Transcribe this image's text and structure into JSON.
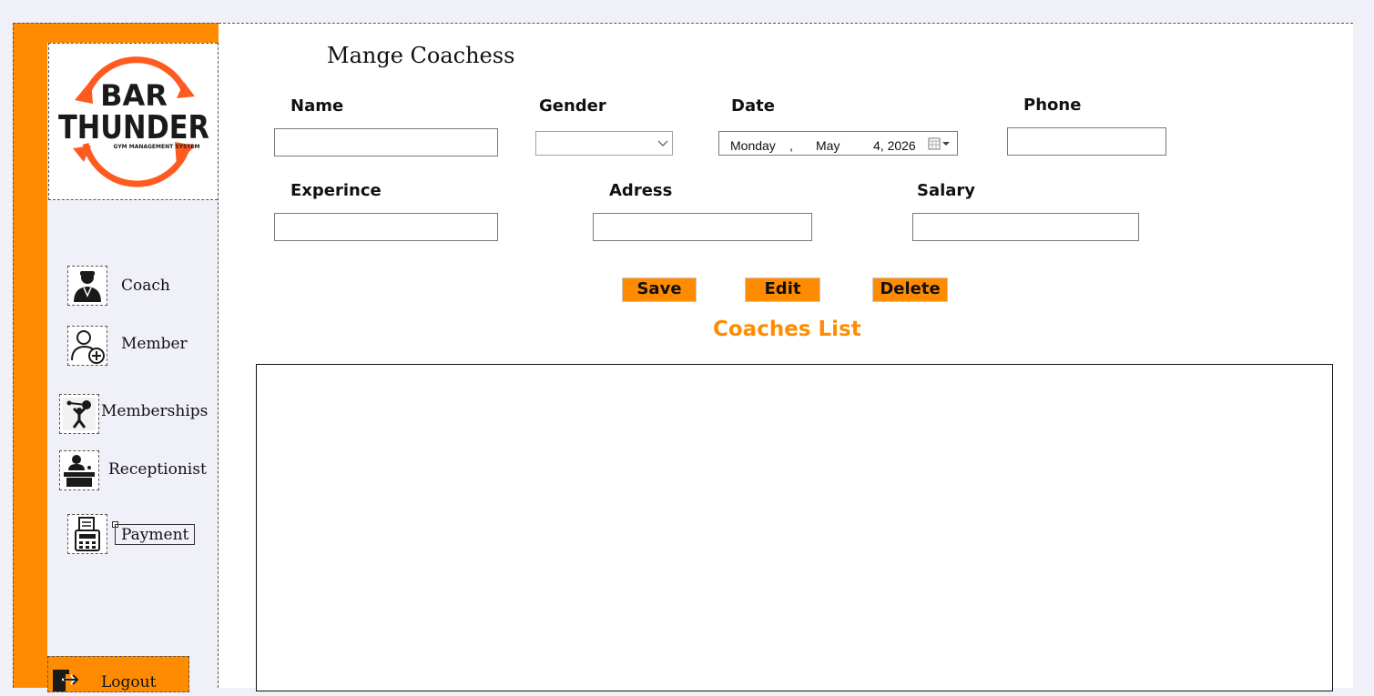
{
  "page": {
    "title": "Mange Coachess"
  },
  "logo": {
    "line1": "BAR",
    "line2": "THUNDER",
    "tagline": "GYM MANAGEMENT SYSTEM",
    "brand_color": "#ff5a1f"
  },
  "sidebar": {
    "items": [
      {
        "label": "Coach",
        "icon": "coach-icon"
      },
      {
        "label": "Member",
        "icon": "add-member-icon"
      },
      {
        "label": "Memberships",
        "icon": "weightlifter-icon"
      },
      {
        "label": "Receptionist",
        "icon": "receptionist-icon"
      },
      {
        "label": "Payment",
        "icon": "cash-register-icon"
      }
    ],
    "logout_label": "Logout",
    "accent_color": "#ff8c00"
  },
  "form": {
    "name_label": "Name",
    "gender_label": "Gender",
    "date_label": "Date",
    "phone_label": "Phone",
    "experience_label": "Experince",
    "address_label": "Adress",
    "salary_label": "Salary",
    "name_value": "",
    "gender_value": "",
    "phone_value": "",
    "experience_value": "",
    "address_value": "",
    "salary_value": "",
    "date": {
      "weekday": "Monday",
      "sep": ",",
      "month": "May",
      "day_year": "4, 2026"
    }
  },
  "buttons": {
    "save": "Save",
    "edit": "Edit",
    "delete": "Delete"
  },
  "list": {
    "title": "Coaches List"
  }
}
